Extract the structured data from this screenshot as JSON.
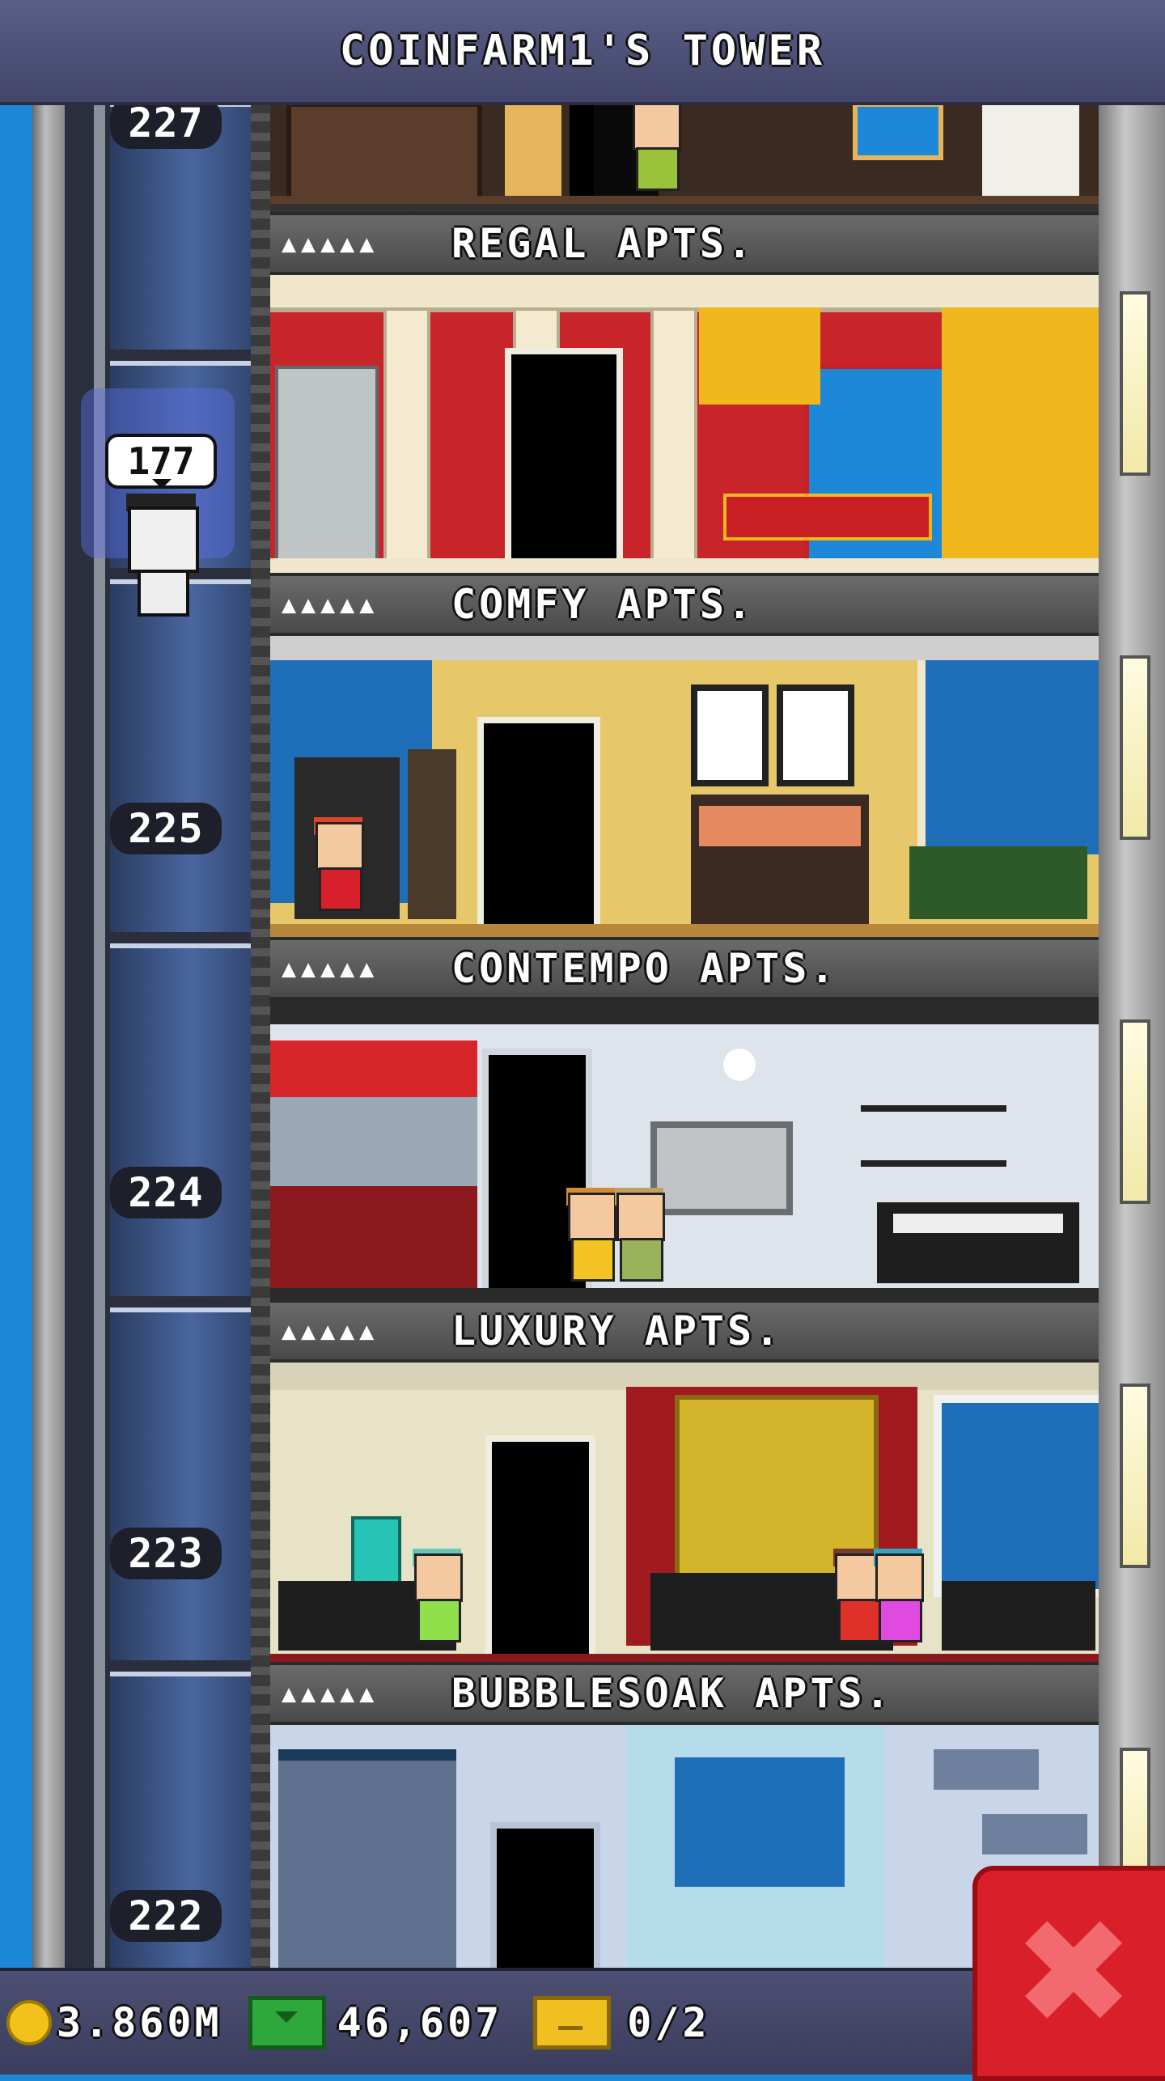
{
  "header": {
    "title": "COINFARM1'S TOWER"
  },
  "elevator": {
    "passenger_bubble": "177"
  },
  "shaft": {
    "floor_numbers": [
      "227",
      "225",
      "224",
      "223",
      "222"
    ]
  },
  "floors": [
    {
      "stars": "▲▲▲▲▲",
      "name": "REGAL APTS."
    },
    {
      "stars": "▲▲▲▲▲",
      "name": "COMFY APTS."
    },
    {
      "stars": "▲▲▲▲▲",
      "name": "CONTEMPO APTS."
    },
    {
      "stars": "▲▲▲▲▲",
      "name": "LUXURY APTS."
    },
    {
      "stars": "▲▲▲▲▲",
      "name": "BUBBLESOAK APTS."
    }
  ],
  "footer": {
    "coins": "3.860M",
    "bux": "46,607",
    "tickets": "0/2"
  },
  "icons": {
    "coin": "coin-icon",
    "bux": "bux-icon",
    "ticket": "ticket-icon",
    "close": "close-icon"
  },
  "colors": {
    "sky": "#1e88d8",
    "close_button": "#d81f2a",
    "bar": "#43466a"
  }
}
